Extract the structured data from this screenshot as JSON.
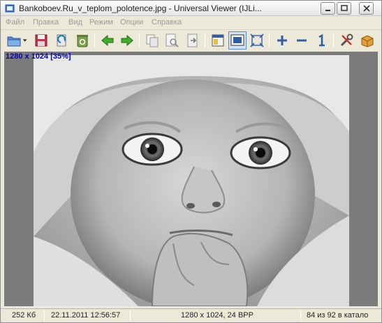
{
  "window": {
    "title": "Bankoboev.Ru_v_teplom_polotence.jpg - Universal Viewer (IJLi..."
  },
  "menu": [
    {
      "label": "Файл"
    },
    {
      "label": "Правка"
    },
    {
      "label": "Вид"
    },
    {
      "label": "Режим"
    },
    {
      "label": "Опции"
    },
    {
      "label": "Справка"
    }
  ],
  "toolbar": {
    "icons": [
      "open-folder-icon",
      "dropdown-arrow-icon",
      "save-icon",
      "reload-icon",
      "recycle-icon",
      "back-arrow-icon",
      "forward-arrow-icon",
      "copy-icon",
      "print-preview-icon",
      "export-icon",
      "fit-width-icon",
      "fit-window-icon",
      "fullscreen-icon",
      "zoom-in-icon",
      "zoom-out-icon",
      "actual-size-icon",
      "settings-icon",
      "package-icon"
    ]
  },
  "viewer": {
    "info_overlay": "1280 x 1024 [35%]",
    "image_description": "black-and-white photo of a baby wrapped in a towel"
  },
  "status": {
    "file_size": "252 Кб",
    "date": "22.11.2011 12:56:57",
    "dimensions": "1280 x 1024, 24 BPP",
    "position": "84 из 92 в катало"
  },
  "colors": {
    "viewport_bg": "#7b7b7b",
    "info_overlay": "#0000cc",
    "chrome": "#ece9d8"
  }
}
